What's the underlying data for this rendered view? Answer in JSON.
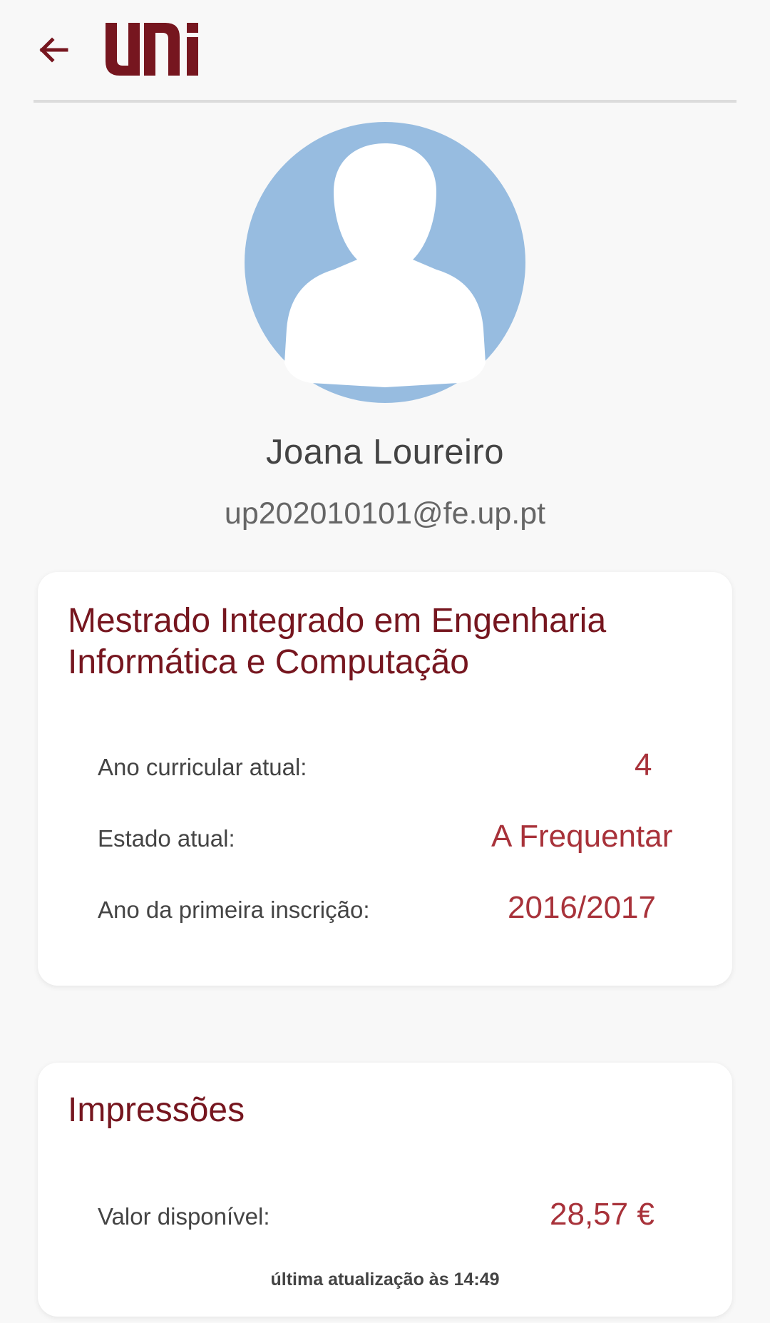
{
  "header": {
    "back_icon": "arrow-back-icon",
    "logo_text": "uni",
    "accent_color": "#76161f"
  },
  "profile": {
    "name": "Joana Loureiro",
    "email": "up202010101@fe.up.pt",
    "avatar_icon": "user-avatar-icon",
    "avatar_color": "#97bce0"
  },
  "course_card": {
    "title": "Mestrado Integrado em Engenharia Informática e Computação",
    "rows": [
      {
        "label": "Ano curricular atual:",
        "value": "4"
      },
      {
        "label": "Estado atual:",
        "value": "A Frequentar"
      },
      {
        "label": "Ano da primeira inscrição:",
        "value": "2016/2017"
      }
    ]
  },
  "print_card": {
    "title": "Impressões",
    "balance_label": "Valor disponível:",
    "balance_value": "28,57 €",
    "last_update": "última atualização às 14:49"
  }
}
